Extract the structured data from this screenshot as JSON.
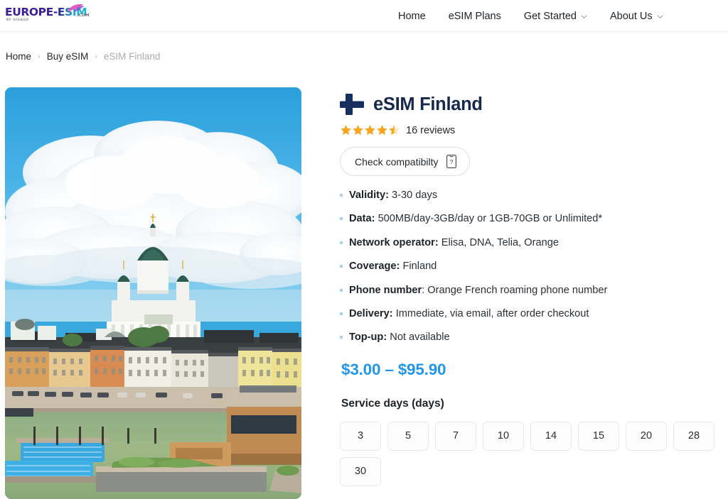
{
  "header": {
    "logo": {
      "part1": "EUROPE",
      "dash": "-",
      "part2": "ESIM",
      "domain": ".COM",
      "tagline": "BY GIGAGO",
      "colors": {
        "purple": "#3b1f97",
        "cyan": "#18b9d8",
        "pink": "#e35bbf"
      }
    },
    "nav": [
      {
        "label": "Home",
        "has_dropdown": false
      },
      {
        "label": "eSIM Plans",
        "has_dropdown": false
      },
      {
        "label": "Get Started",
        "has_dropdown": true
      },
      {
        "label": "About Us",
        "has_dropdown": true
      }
    ]
  },
  "breadcrumb": {
    "items": [
      {
        "label": "Home",
        "current": false
      },
      {
        "label": "Buy eSIM",
        "current": false
      },
      {
        "label": "eSIM Finland",
        "current": true
      }
    ],
    "separator": "›"
  },
  "product": {
    "image_alt": "Helsinki Cathedral and harbour waterfront with Allas Sea Pool under blue sky with large white clouds",
    "title": "eSIM Finland",
    "flag_icon": "finland-flag-cross-icon",
    "flag_color": "#16305e",
    "rating": {
      "value": 4.5,
      "stars_total": 5,
      "full_stars": 4,
      "half_stars": 1,
      "star_color": "#f5a623",
      "reviews_text": "16 reviews",
      "reviews_count": 16
    },
    "compatibility": {
      "label": "Check compatibilty",
      "icon": "phone-question-icon"
    },
    "specs": [
      {
        "label": "Validity:",
        "value": "3-30 days"
      },
      {
        "label": "Data:",
        "value": "500MB/day-3GB/day or 1GB-70GB or Unlimited*"
      },
      {
        "label": "Network operator:",
        "value": "Elisa, DNA, Telia, Orange"
      },
      {
        "label": "Coverage:",
        "value": "Finland"
      },
      {
        "label": "Phone number",
        "value": ": Orange French roaming phone number"
      },
      {
        "label": "Delivery:",
        "value": "Immediate, via email, after order checkout"
      },
      {
        "label": "Top-up:",
        "value": "Not available"
      }
    ],
    "price": {
      "text": "$3.00 – $95.90",
      "min": 3.0,
      "max": 95.9,
      "currency": "USD",
      "color": "#2196ea"
    },
    "variation": {
      "label": "Service days (days)",
      "options": [
        "3",
        "5",
        "7",
        "10",
        "14",
        "15",
        "20",
        "28",
        "30"
      ],
      "selected": null
    }
  }
}
